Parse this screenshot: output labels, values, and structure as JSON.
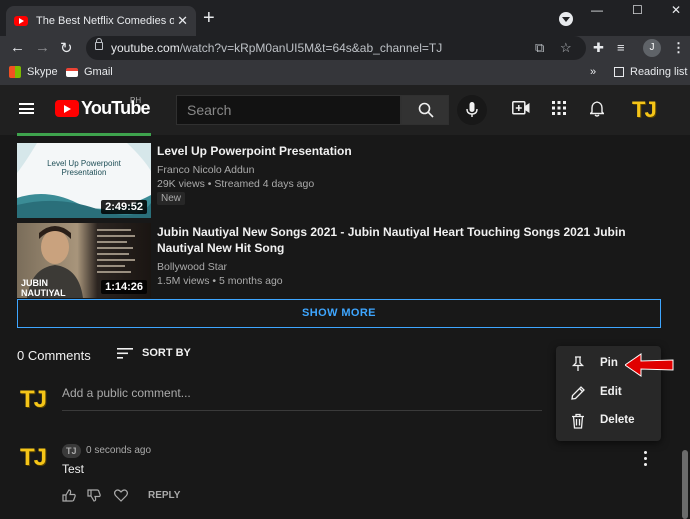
{
  "browser": {
    "tab_title": "The Best Netflix Comedies of June",
    "tab_close": "✕",
    "new_tab": "+",
    "win_min": "—",
    "win_max": "☐",
    "win_close": "✕",
    "url_host": "youtube.com",
    "url_rest": "/watch?v=kRpM0anUI5M&t=64s&ab_channel=TJ",
    "profile_initial": "J",
    "bookmarks": [
      {
        "label": "Skype"
      },
      {
        "label": "Gmail"
      }
    ],
    "bookmarks_more": "»",
    "reading_list": "Reading list"
  },
  "youtube": {
    "logo_text": "YouTube",
    "region": "PH",
    "search_placeholder": "Search",
    "avatar_initials": "TJ"
  },
  "videos": [
    {
      "title": "Level Up Powerpoint Presentation",
      "channel": "Franco Nicolo Addun",
      "meta": "29K views • Streamed 4 days ago",
      "badge": "New",
      "duration": "2:49:52",
      "thumb_title": "Level Up Powerpoint Presentation"
    },
    {
      "title": "Jubin Nautiyal New Songs 2021 - Jubin Nautiyal Heart Touching Songs 2021 Jubin Nautiyal New Hit Song",
      "channel": "Bollywood Star",
      "meta": "1.5M views • 5 months ago",
      "duration": "1:14:26",
      "thumb_title": "JUBIN NAUTIYAL"
    }
  ],
  "show_more": "SHOW MORE",
  "comments": {
    "count_label": "0 Comments",
    "sort_label": "SORT BY",
    "add_placeholder": "Add a public comment...",
    "user_initials": "TJ",
    "items": [
      {
        "author": "TJ",
        "time": "0 seconds ago",
        "text": "Test",
        "reply_label": "REPLY"
      }
    ]
  },
  "context_menu": {
    "items": [
      {
        "label": "Pin",
        "icon": "pin-icon"
      },
      {
        "label": "Edit",
        "icon": "pencil-icon"
      },
      {
        "label": "Delete",
        "icon": "trash-icon"
      }
    ]
  },
  "colors": {
    "accent_blue": "#3ea6ff",
    "youtube_red": "#ff0000",
    "annotation_arrow": "#e00000",
    "avatar_yellow": "#f5c518"
  }
}
